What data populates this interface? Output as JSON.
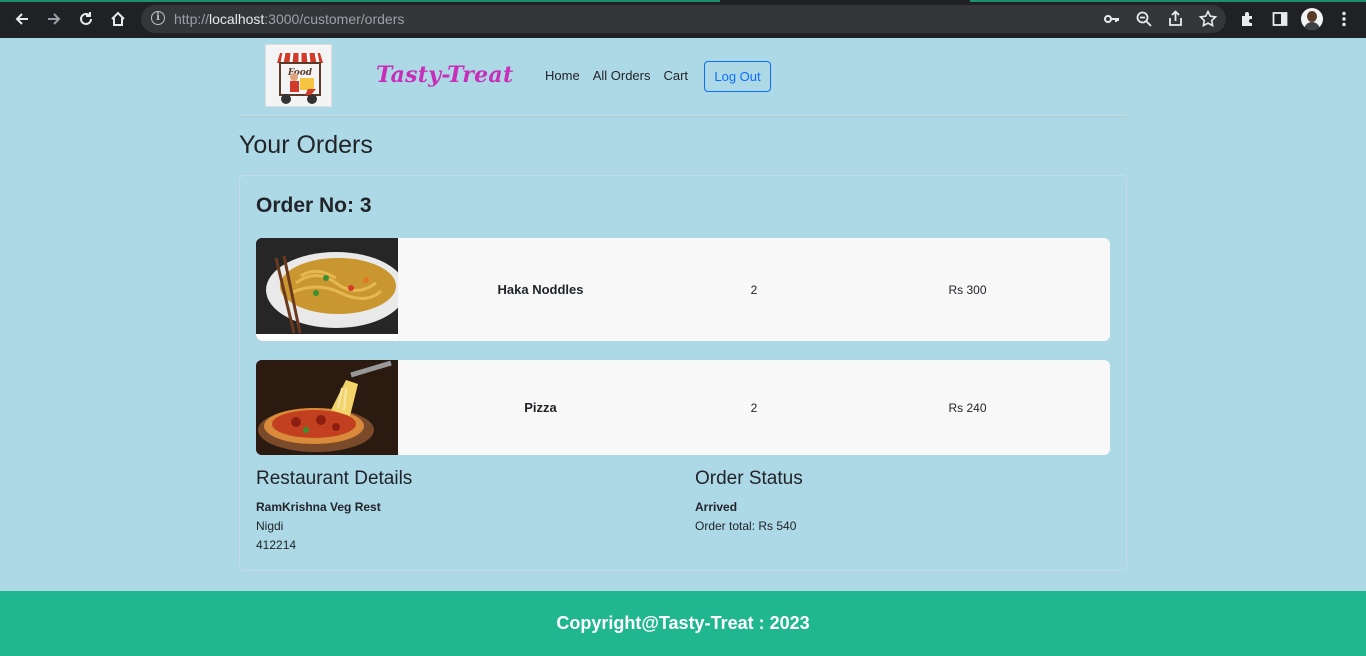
{
  "browser": {
    "url_scheme": "http://",
    "url_host": "localhost",
    "url_path": ":3000/customer/orders"
  },
  "navbar": {
    "brand": "Tasty-Treat",
    "logo_text": "Food",
    "links": [
      "Home",
      "All Orders",
      "Cart"
    ],
    "logout_label": "Log Out"
  },
  "page": {
    "title": "Your Orders"
  },
  "order": {
    "title": "Order No: 3",
    "items": [
      {
        "name": "Haka Noddles",
        "quantity": "2",
        "price": "Rs 300",
        "image": "noodles-image"
      },
      {
        "name": "Pizza",
        "quantity": "2",
        "price": "Rs 240",
        "image": "pizza-image"
      }
    ],
    "restaurant": {
      "heading": "Restaurant Details",
      "name": "RamKrishna Veg Rest",
      "area": "Nigdi",
      "pincode": "412214"
    },
    "status": {
      "heading": "Order Status",
      "state": "Arrived",
      "total": "Order total: Rs 540"
    }
  },
  "footer": {
    "text": "Copyright@Tasty-Treat : 2023"
  },
  "colors": {
    "page_bg": "#add8e6",
    "brand": "#c82fb8",
    "footer_bg": "#20b790",
    "button": "#0d6efd"
  }
}
